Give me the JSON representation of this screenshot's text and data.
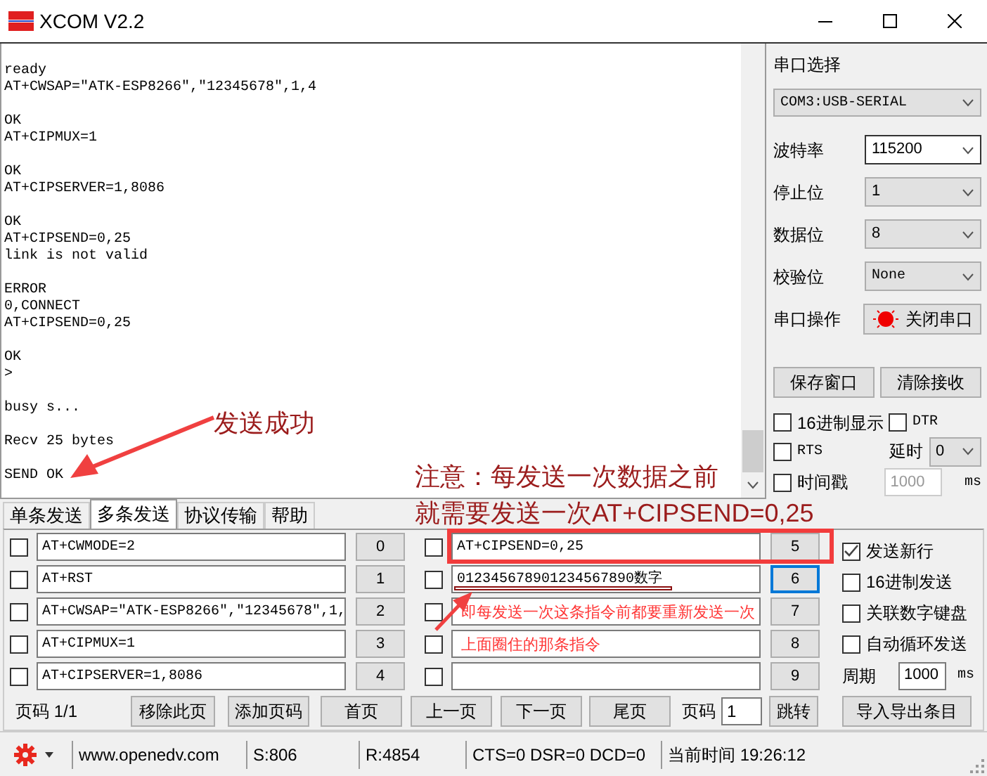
{
  "window": {
    "title": "XCOM V2.2"
  },
  "receive_log": [
    [
      "ready",
      "AT+CWSAP=\"ATK-ESP8266\",\"12345678\",1,4"
    ],
    [
      "OK",
      "AT+CIPMUX=1"
    ],
    [
      "OK",
      "AT+CIPSERVER=1,8086"
    ],
    [
      "OK",
      "AT+CIPSEND=0,25",
      "link is not valid"
    ],
    [
      "ERROR",
      "0,CONNECT",
      "AT+CIPSEND=0,25"
    ],
    [
      "OK",
      ">"
    ],
    [
      "busy s..."
    ],
    [
      "Recv 25 bytes"
    ],
    [
      "SEND OK"
    ]
  ],
  "serial_panel": {
    "port_label": "串口选择",
    "port": "COM3:USB-SERIAL",
    "settings": [
      {
        "label": "波特率",
        "value": "115200",
        "focused": true
      },
      {
        "label": "停止位",
        "value": "1",
        "focused": false
      },
      {
        "label": "数据位",
        "value": "8",
        "focused": false
      },
      {
        "label": "校验位",
        "value": "None",
        "focused": false
      }
    ],
    "operation_label": "串口操作",
    "toggle_button": "关闭串口",
    "port_open": true,
    "buttons": [
      "保存窗口",
      "清除接收"
    ],
    "options": [
      {
        "label": "16进制显示",
        "checked": false
      },
      {
        "label": "DTR",
        "checked": false
      },
      {
        "label": "RTS",
        "checked": false
      }
    ],
    "delay_label": "延时",
    "delay": "0",
    "timestamp": {
      "label": "时间戳",
      "checked": false
    },
    "timestamp_interval": "1000",
    "unit": "ms"
  },
  "tabs": [
    {
      "label": "单条发送",
      "selected": false
    },
    {
      "label": "多条发送",
      "selected": true
    },
    {
      "label": "协议传输",
      "selected": false
    },
    {
      "label": "帮助",
      "selected": false
    }
  ],
  "send_list": [
    {
      "checked": false,
      "value": "AT+CWMODE=2",
      "button": "0",
      "focused": false
    },
    {
      "checked": false,
      "value": "AT+RST",
      "button": "1",
      "focused": false
    },
    {
      "checked": false,
      "value": "AT+CWSAP=\"ATK-ESP8266\",\"12345678\",1,",
      "button": "2",
      "focused": false
    },
    {
      "checked": false,
      "value": "AT+CIPMUX=1",
      "button": "3",
      "focused": false
    },
    {
      "checked": false,
      "value": "AT+CIPSERVER=1,8086",
      "button": "4",
      "focused": false
    },
    {
      "checked": false,
      "value": "AT+CIPSEND=0,25",
      "button": "5",
      "focused": false
    },
    {
      "checked": false,
      "value": "012345678901234567890数字",
      "button": "6",
      "focused": true
    },
    {
      "checked": false,
      "button": "7",
      "focused": false
    },
    {
      "checked": false,
      "button": "8",
      "focused": false
    },
    {
      "checked": false,
      "button": "9",
      "focused": false
    }
  ],
  "send_options": [
    {
      "label": "发送新行",
      "checked": true
    },
    {
      "label": "16进制发送",
      "checked": false
    },
    {
      "label": "关联数字键盘",
      "checked": false
    },
    {
      "label": "自动循环发送",
      "checked": false
    }
  ],
  "period_label": "周期",
  "period": "1000",
  "period_unit": "ms",
  "pager": {
    "page_info": "页码 1/1",
    "buttons": [
      "移除此页",
      "添加页码",
      "首页",
      "上一页",
      "下一页",
      "尾页"
    ],
    "page_label": "页码",
    "page": "1",
    "jump": "跳转",
    "import_export": "导入导出条目"
  },
  "status_bar": {
    "website": "www.openedv.com",
    "sent": "S:806",
    "received": "R:4854",
    "lines": "CTS=0 DSR=0 DCD=0",
    "time": "当前时间 19:26:12"
  },
  "annotations": [
    {
      "kind": "callout",
      "lines": [
        "发送成功"
      ]
    },
    {
      "kind": "note",
      "lines": [
        "注意：每发送一次数据之前",
        "就需要发送一次AT+CIPSEND=0,25"
      ]
    },
    {
      "kind": "hint",
      "lines": [
        "即每发送一次这条指令前都要重新发送一次",
        "上面圈住的那条指令"
      ]
    }
  ]
}
